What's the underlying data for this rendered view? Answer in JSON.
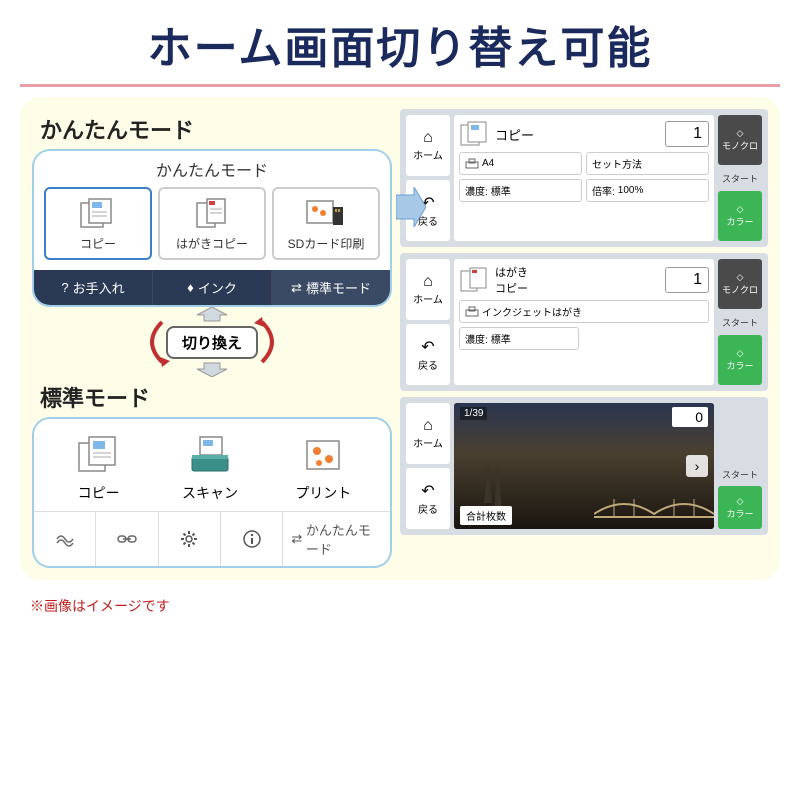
{
  "title": "ホーム画面切り替え可能",
  "footnote": "※画像はイメージです",
  "switch_label": "切り換え",
  "easy_mode": {
    "label": "かんたんモード",
    "header": "かんたんモード",
    "items": [
      {
        "label": "コピー"
      },
      {
        "label": "はがきコピー"
      },
      {
        "label": "SDカード印刷"
      }
    ],
    "bottom": {
      "maintenance": "お手入れ",
      "ink": "インク",
      "std_mode": "標準モード"
    }
  },
  "std_mode": {
    "label": "標準モード",
    "items": [
      {
        "label": "コピー"
      },
      {
        "label": "スキャン"
      },
      {
        "label": "プリント"
      }
    ],
    "bottom_easy": "かんたんモード"
  },
  "screens": {
    "nav_home": "ホーム",
    "nav_back": "戻る",
    "mono": "モノクロ",
    "start": "スタート",
    "color": "カラー",
    "copy": {
      "title": "コピー",
      "count": "1",
      "paper": "A4",
      "set_method": "セット方法",
      "density_label": "濃度:",
      "density_value": "標準",
      "scale_label": "倍率:",
      "scale_value": "100%"
    },
    "hagaki": {
      "title": "はがき\nコピー",
      "count": "1",
      "paper": "インクジェットはがき",
      "density_label": "濃度:",
      "density_value": "標準"
    },
    "photo": {
      "counter": "1/39",
      "count": "0",
      "total_label": "合計枚数"
    }
  }
}
